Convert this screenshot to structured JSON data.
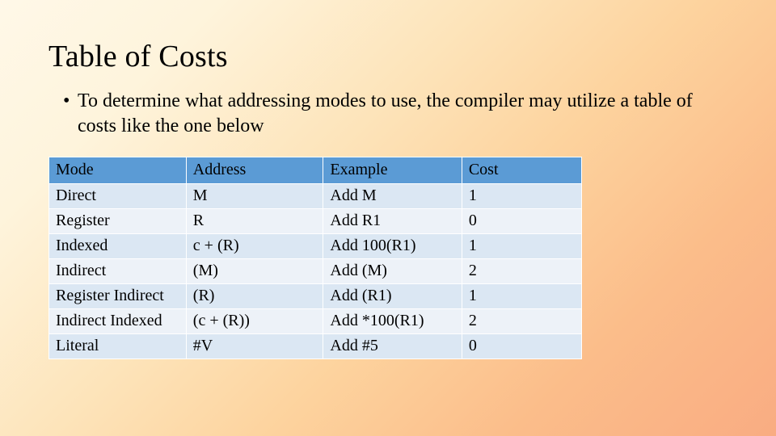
{
  "title": "Table of Costs",
  "bullet": {
    "marker": "•",
    "text": "To determine what addressing modes to use, the compiler may utilize a table of costs like the one below"
  },
  "chart_data": {
    "type": "table",
    "headers": [
      "Mode",
      "Address",
      "Example",
      "Cost"
    ],
    "rows": [
      {
        "mode": "Direct",
        "address": "M",
        "example": "Add M",
        "cost": "1"
      },
      {
        "mode": "Register",
        "address": "R",
        "example": "Add R1",
        "cost": "0"
      },
      {
        "mode": "Indexed",
        "address": "c + (R)",
        "example": "Add 100(R1)",
        "cost": "1"
      },
      {
        "mode": "Indirect",
        "address": "(M)",
        "example": "Add (M)",
        "cost": "2"
      },
      {
        "mode": "Register Indirect",
        "address": "(R)",
        "example": "Add (R1)",
        "cost": "1"
      },
      {
        "mode": "Indirect Indexed",
        "address": "(c + (R))",
        "example": "Add *100(R1)",
        "cost": "2"
      },
      {
        "mode": "Literal",
        "address": "#V",
        "example": "Add #5",
        "cost": "0"
      }
    ]
  }
}
